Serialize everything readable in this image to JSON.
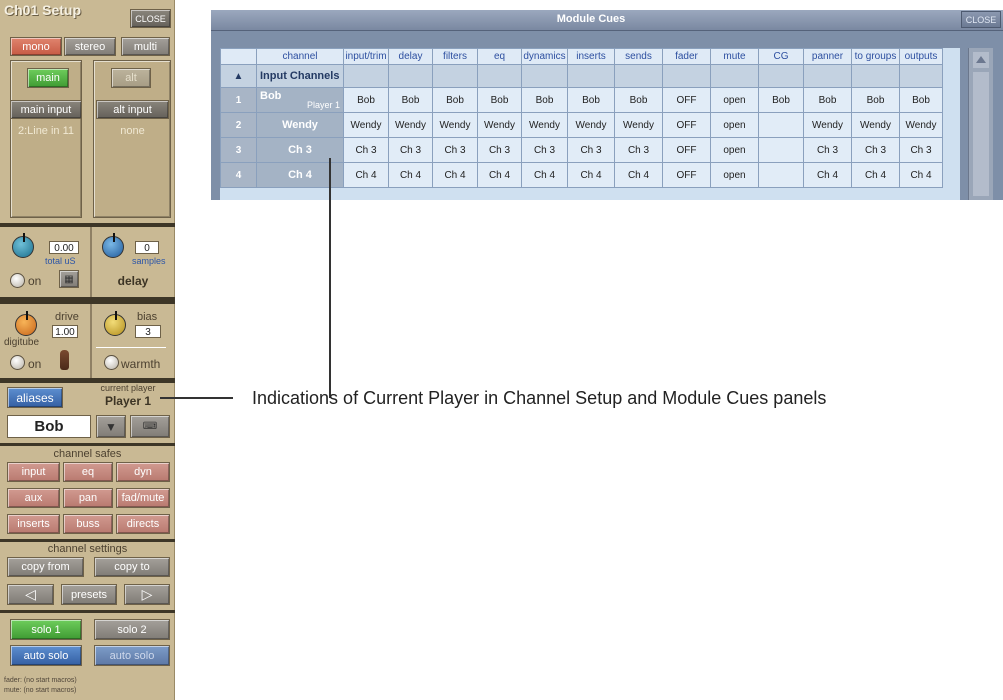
{
  "left_panel": {
    "title": "Ch01 Setup",
    "close": "CLOSE",
    "format": {
      "mono": "mono",
      "stereo": "stereo",
      "multi": "multi"
    },
    "input": {
      "main": "main",
      "alt": "alt",
      "main_input": "main input",
      "alt_input": "alt input",
      "main_value": "2:Line in 11",
      "alt_value": "none"
    },
    "delay": {
      "total_value": "0.00",
      "total_label": "total  uS",
      "samples_value": "0",
      "samples_label": "samples",
      "on_label": "on",
      "title": "delay"
    },
    "digitube": {
      "drive_label": "drive",
      "drive_value": "1.00",
      "name": "digitube",
      "bias_label": "bias",
      "bias_value": "3",
      "on_label": "on",
      "warmth_label": "warmth"
    },
    "aliases": {
      "button": "aliases",
      "current_player_label": "current player",
      "current_player_value": "Player 1",
      "alias_value": "Bob"
    },
    "channel_safes": {
      "title": "channel safes",
      "items": [
        "input",
        "eq",
        "dyn",
        "aux",
        "pan",
        "fad/mute",
        "inserts",
        "buss",
        "directs"
      ]
    },
    "channel_settings": {
      "title": "channel settings",
      "copy_from": "copy from",
      "copy_to": "copy to",
      "presets": "presets"
    },
    "solo": {
      "solo1": "solo 1",
      "solo2": "solo 2",
      "auto_solo": "auto solo",
      "auto_solo_2": "auto solo"
    },
    "footer": {
      "fader": "fader:  (no start macros)",
      "mute": "mute:  (no start macros)"
    }
  },
  "module_cues": {
    "title": "Module Cues",
    "close": "CLOSE",
    "columns": [
      "channel",
      "input/trim",
      "delay",
      "filters",
      "eq",
      "dynamics",
      "inserts",
      "sends",
      "fader",
      "mute",
      "CG",
      "panner",
      "to groups",
      "outputs"
    ],
    "group_label": "Input Channels",
    "rows": [
      {
        "num": "1",
        "channel": "Bob",
        "player": "Player 1",
        "cells": [
          "Bob",
          "Bob",
          "Bob",
          "Bob",
          "Bob",
          "Bob",
          "Bob",
          "OFF",
          "open",
          "Bob",
          "Bob",
          "Bob",
          "Bob"
        ]
      },
      {
        "num": "2",
        "channel": "Wendy",
        "cells": [
          "Wendy",
          "Wendy",
          "Wendy",
          "Wendy",
          "Wendy",
          "Wendy",
          "Wendy",
          "OFF",
          "open",
          "",
          "Wendy",
          "Wendy",
          "Wendy"
        ]
      },
      {
        "num": "3",
        "channel": "Ch 3",
        "cells": [
          "Ch 3",
          "Ch 3",
          "Ch 3",
          "Ch 3",
          "Ch 3",
          "Ch 3",
          "Ch 3",
          "OFF",
          "open",
          "",
          "Ch 3",
          "Ch 3",
          "Ch 3"
        ]
      },
      {
        "num": "4",
        "channel": "Ch 4",
        "cells": [
          "Ch 4",
          "Ch 4",
          "Ch 4",
          "Ch 4",
          "Ch 4",
          "Ch 4",
          "Ch 4",
          "OFF",
          "open",
          "",
          "Ch 4",
          "Ch 4",
          "Ch 4"
        ]
      }
    ]
  },
  "annotation": {
    "text": "Indications of Current Player in Channel Setup and Module Cues panels"
  }
}
